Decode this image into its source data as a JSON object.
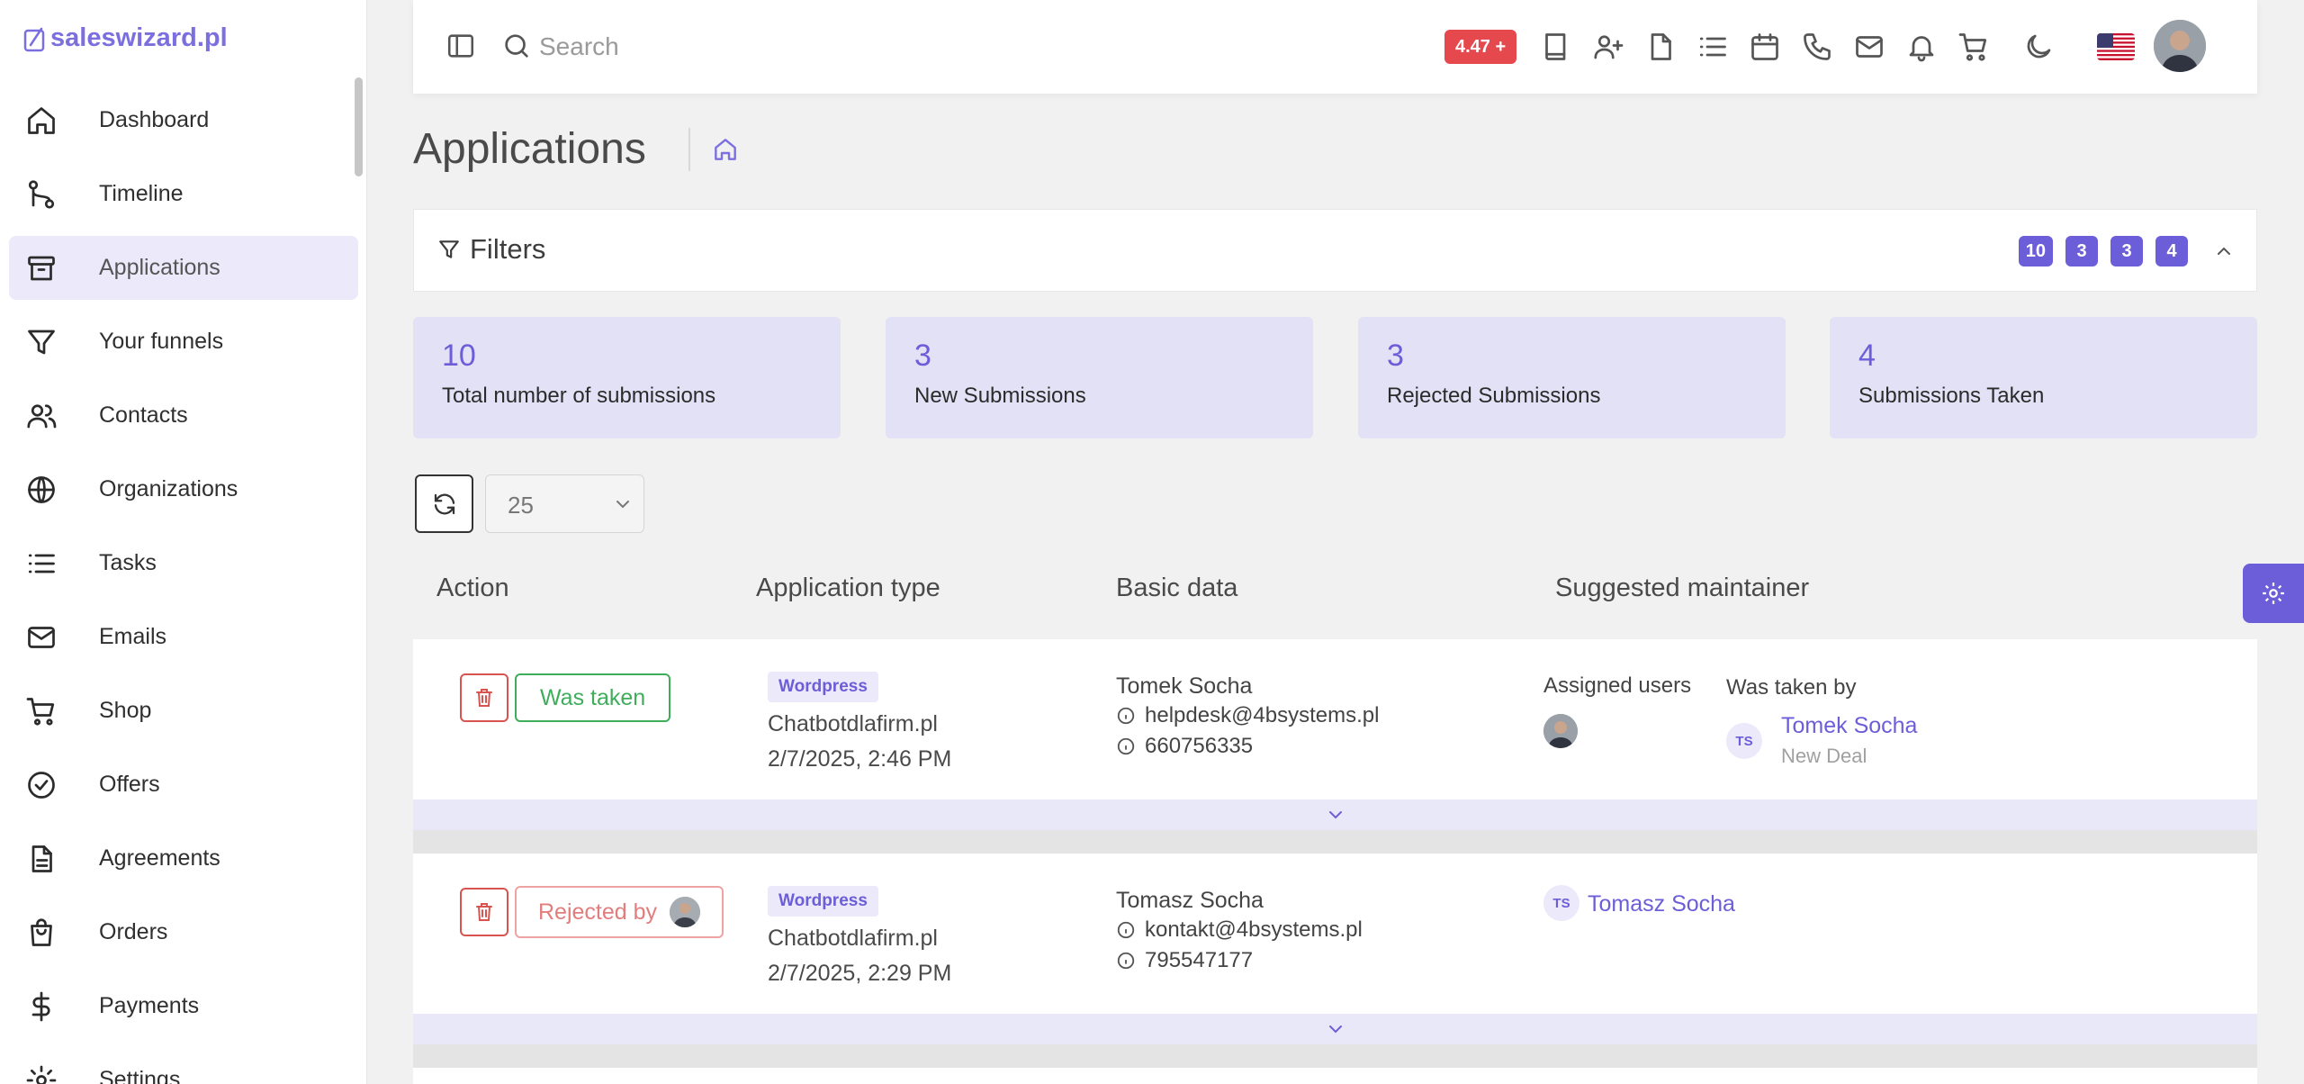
{
  "brand": {
    "name": "saleswizard.pl"
  },
  "sidebar": {
    "items": [
      {
        "label": "Dashboard",
        "icon": "home-icon"
      },
      {
        "label": "Timeline",
        "icon": "git-branch-icon"
      },
      {
        "label": "Applications",
        "icon": "archive-icon",
        "active": true
      },
      {
        "label": "Your funnels",
        "icon": "filter-icon"
      },
      {
        "label": "Contacts",
        "icon": "users-icon"
      },
      {
        "label": "Organizations",
        "icon": "globe-icon"
      },
      {
        "label": "Tasks",
        "icon": "list-icon"
      },
      {
        "label": "Emails",
        "icon": "mail-icon"
      },
      {
        "label": "Shop",
        "icon": "cart-icon"
      },
      {
        "label": "Offers",
        "icon": "check-circle-icon"
      },
      {
        "label": "Agreements",
        "icon": "document-icon"
      },
      {
        "label": "Orders",
        "icon": "shopping-bag-icon"
      },
      {
        "label": "Payments",
        "icon": "dollar-icon"
      },
      {
        "label": "Settings",
        "icon": "gear-icon"
      }
    ]
  },
  "topbar": {
    "search_placeholder": "Search",
    "version_badge": "4.47 +",
    "icons": [
      "book-icon",
      "user-plus-icon",
      "file-icon",
      "list-icon",
      "calendar-icon",
      "phone-icon",
      "mail-icon",
      "bell-icon",
      "cart-icon",
      "moon-icon"
    ]
  },
  "page": {
    "title": "Applications"
  },
  "filters": {
    "title": "Filters",
    "chips": [
      "10",
      "3",
      "3",
      "4"
    ]
  },
  "stats": [
    {
      "value": "10",
      "label": "Total number of submissions"
    },
    {
      "value": "3",
      "label": "New Submissions"
    },
    {
      "value": "3",
      "label": "Rejected Submissions"
    },
    {
      "value": "4",
      "label": "Submissions Taken"
    }
  ],
  "controls": {
    "page_size": "25"
  },
  "table": {
    "headers": {
      "action": "Action",
      "app_type": "Application type",
      "basic_data": "Basic data",
      "maintainer": "Suggested maintainer"
    },
    "rows": [
      {
        "status_label": "Was taken",
        "badge": "Wordpress",
        "source": "Chatbotdlafirm.pl",
        "date": "2/7/2025, 2:46 PM",
        "name": "Tomek Socha",
        "email": "helpdesk@4bsystems.pl",
        "phone": "660756335",
        "assigned_label": "Assigned users",
        "taken_label": "Was taken by",
        "taker_initials": "TS",
        "taker_name": "Tomek Socha",
        "taker_sub": "New Deal"
      },
      {
        "status_label": "Rejected by",
        "badge": "Wordpress",
        "source": "Chatbotdlafirm.pl",
        "date": "2/7/2025, 2:29 PM",
        "name": "Tomasz Socha",
        "email": "kontakt@4bsystems.pl",
        "phone": "795547177",
        "maintainer_initials": "TS",
        "maintainer_name": "Tomasz Socha"
      }
    ]
  },
  "colors": {
    "accent": "#6c5ed8",
    "danger": "#e5484d",
    "success": "#3fae5b",
    "stat_bg": "#e3e1f5"
  }
}
